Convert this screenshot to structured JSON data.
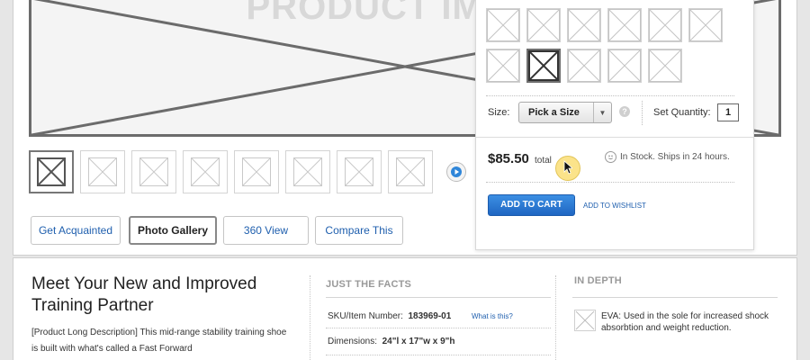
{
  "hero": {
    "text": "PRODUCT IMAGE"
  },
  "thumbnails": {
    "count": 8,
    "selected_index": 0
  },
  "tabs": [
    {
      "label": "Get Acquainted",
      "active": false
    },
    {
      "label": "Photo Gallery",
      "active": true
    },
    {
      "label": "360 View",
      "active": false
    },
    {
      "label": "Compare This",
      "active": false
    }
  ],
  "popover": {
    "swatch_rows": [
      6,
      5
    ],
    "selected_swatch": {
      "row": 1,
      "col": 1
    },
    "size_label": "Size:",
    "size_select": "Pick a Size",
    "help": "?",
    "qty_label": "Set Quantity:",
    "qty_value": "1",
    "price": "$85.50",
    "price_suffix": "total",
    "stock": "In Stock. Ships in 24 hours.",
    "add_to_cart": "ADD TO CART",
    "wishlist": "ADD TO WISHLIST"
  },
  "description": {
    "title": "Meet Your New and Improved Training Partner",
    "body": "[Product Long Description]  This mid-range stability training shoe is built with what's called a Fast Forward"
  },
  "facts": {
    "heading": "JUST THE FACTS",
    "sku_label": "SKU/Item Number:",
    "sku_value": "183969-01",
    "sku_link": "What is this?",
    "dimensions_label": "Dimensions:",
    "dimensions_value": "24\"l x 17\"w x 9\"h"
  },
  "depth": {
    "heading": "IN DEPTH",
    "item": "EVA: Used in the sole for increased shock absorbtion and weight reduction."
  },
  "colors": {
    "link": "#1f5fae",
    "button": "#1f66c2",
    "cursor_halo": "#fbe38a"
  }
}
